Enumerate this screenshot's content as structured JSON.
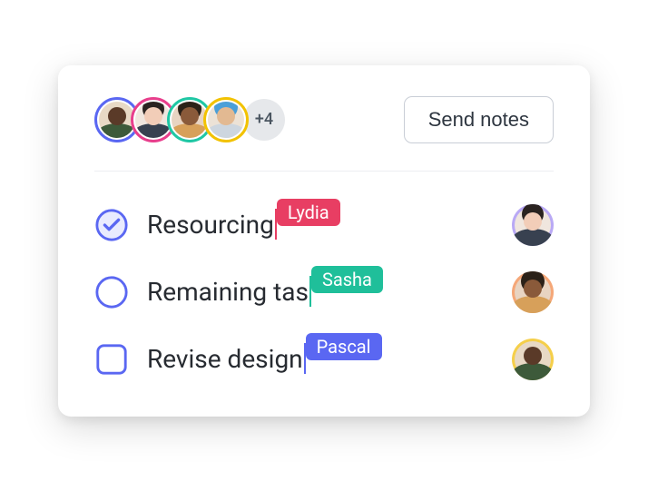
{
  "header": {
    "avatars": [
      {
        "ring": "#5a67f2",
        "face": "face-a"
      },
      {
        "ring": "#e83e8c",
        "face": "face-b"
      },
      {
        "ring": "#1fc7a4",
        "face": "face-c"
      },
      {
        "ring": "#f2c200",
        "face": "face-d"
      }
    ],
    "more_count": "+4",
    "send_button": "Send notes"
  },
  "tasks": [
    {
      "label": "Resourcing",
      "check_type": "circle-checked",
      "editor": {
        "name": "Lydia",
        "color": "#e83e63"
      },
      "assignee": {
        "bg": "#b9a9f5",
        "face": "face-b"
      }
    },
    {
      "label": "Remaining tas",
      "check_type": "circle",
      "editor": {
        "name": "Sasha",
        "color": "#1fbf9a"
      },
      "assignee": {
        "bg": "#f5a778",
        "face": "face-c"
      }
    },
    {
      "label": "Revise design",
      "check_type": "square",
      "editor": {
        "name": "Pascal",
        "color": "#5a67f2"
      },
      "assignee": {
        "bg": "#f5cf4a",
        "face": "face-a"
      }
    }
  ],
  "colors": {
    "check_stroke": "#5a67f2",
    "check_fill": "#e9ebfe"
  }
}
